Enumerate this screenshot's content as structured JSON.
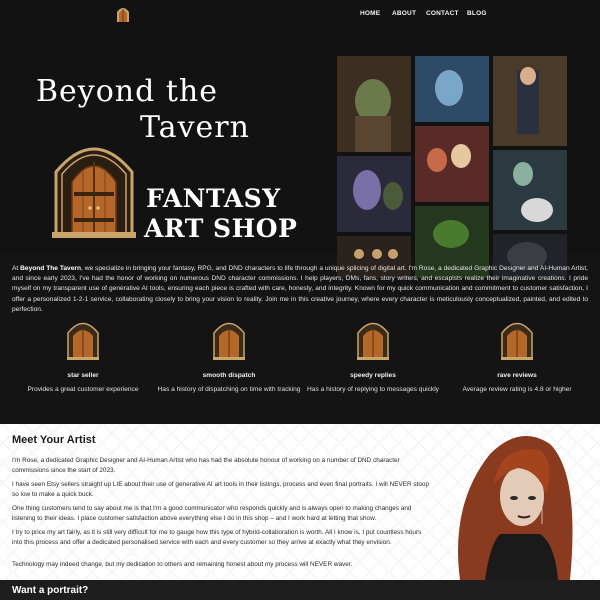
{
  "nav": {
    "items": [
      {
        "label": "HOME"
      },
      {
        "label": "ABOUT"
      },
      {
        "label": "CONTACT"
      },
      {
        "label": "BLOG"
      }
    ]
  },
  "hero": {
    "title_line1": "Beyond the",
    "title_line2": "Tavern",
    "subtitle_line1": "FANTASY",
    "subtitle_line2": "ART SHOP"
  },
  "intro": {
    "lead": "At",
    "brand": "Beyond The Tavern",
    "text": ", we specialize in bringing your fantasy, RPG, and DND characters to life through a unique splicing of digital art. I'm Rose, a dedicated Graphic Designer and AI-Human Artist, and since early 2023, I've had the honor of working on numerous DND character commissions. I help players, DMs, fans, story writers, and escapists realize their imaginative creations. I pride myself on my transparent use of generative AI tools, ensuring each piece is crafted with care, honesty, and integrity. Known for my quick communication and commitment to customer satisfaction, I offer a personalized 1-2-1 service, collaborating closely to bring your vision to reality. Join me in this creative journey, where every character is meticulously conceptualized, painted, and edited to perfection."
  },
  "features": [
    {
      "title": "star seller",
      "desc": "Provides a great customer experience"
    },
    {
      "title": "smooth dispatch",
      "desc": "Has a history of dispatching on time with tracking"
    },
    {
      "title": "speedy replies",
      "desc": "Has a history of replying to messages quickly"
    },
    {
      "title": "rave reviews",
      "desc": "Average review rating is 4.8 or higher"
    }
  ],
  "meet": {
    "heading": "Meet Your Artist",
    "paragraphs": [
      "I'm Rose, a dedicated Graphic Designer and AI-Human Artist who has had the absolute honour of working on a number of DND character commissions since the start of 2023.",
      "I have seen Etsy sellers straight up LIE about their use of generative AI art tools in their listings, process and even final portraits. I will NEVER stoop so low to make a quick buck.",
      "One thing customers tend to say about me is that I'm a good communicator who responds quickly and is always open to making changes and listening to their ideas. I place customer satisfaction above everything else I do in this shop – and I work hard at letting that show.",
      "I try to price my art fairly, as it is still very difficult for me to gauge how this type of hybrid-collaboration is worth. All I know is, I put countless hours into this process and offer a dedicated personalised service with each and every customer so they arrive at exactly what they envision.",
      "Technology may indeed change, but my dedication to others and remaining honest about my process will NEVER waver."
    ]
  },
  "want": {
    "heading": "Want a portrait?"
  },
  "colors": {
    "background": "#141414",
    "door_wood": "#b5672a",
    "door_frame": "#caa46a",
    "text_light": "#ffffff"
  }
}
